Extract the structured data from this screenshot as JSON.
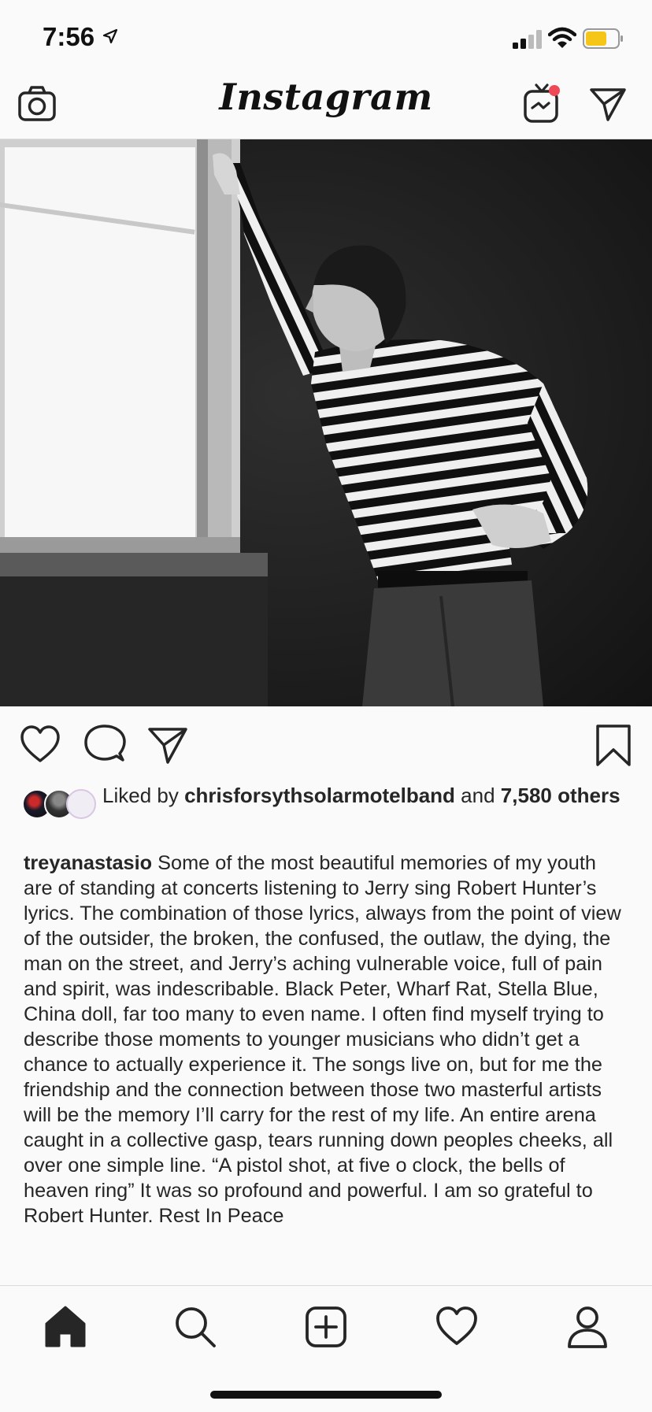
{
  "status_bar": {
    "time": "7:56",
    "icons": [
      "location-arrow-icon",
      "cellular-signal-icon",
      "wifi-icon",
      "battery-icon"
    ],
    "battery_color": "#f5c518"
  },
  "nav": {
    "logo_text": "Instagram",
    "icons": [
      "camera-icon",
      "igtv-icon",
      "direct-message-icon"
    ],
    "notification_dot_color": "#ed4956"
  },
  "post": {
    "image_alt": "Black and white photo of a man in a striped long-sleeve shirt leaning against a window",
    "actions": [
      "heart-icon",
      "comment-icon",
      "share-icon",
      "bookmark-icon"
    ],
    "liked_by_prefix": "Liked by",
    "liked_by_user": "chrisforsythsolarmotelband",
    "liked_by_and": "and",
    "liked_by_others": "7,580 others",
    "caption_user": "treyanastasio",
    "caption_text": "Some of the most beautiful memories of my youth are of standing at concerts listening to Jerry sing Robert Hunter’s lyrics. The combination of those lyrics, always from the point of view of the outsider, the broken, the confused, the outlaw, the dying, the man on the street, and Jerry’s aching vulnerable voice, full of pain and spirit, was indescribable.  Black Peter, Wharf Rat, Stella Blue, China doll, far too many to even name.  I often find myself trying to describe those moments to younger musicians who didn’t get a chance to actually experience it. The songs live on, but for me the friendship and the connection between those two masterful artists will be the memory I’ll carry for the rest of my life.  An entire arena caught in a collective gasp, tears running down peoples cheeks, all over one simple line. “A pistol shot, at five o clock, the bells of heaven ring”  It was so profound and powerful. I am so grateful to Robert Hunter. Rest In Peace"
  },
  "tab_bar": {
    "items": [
      "home-icon",
      "search-icon",
      "new-post-icon",
      "activity-heart-icon",
      "profile-icon"
    ]
  }
}
